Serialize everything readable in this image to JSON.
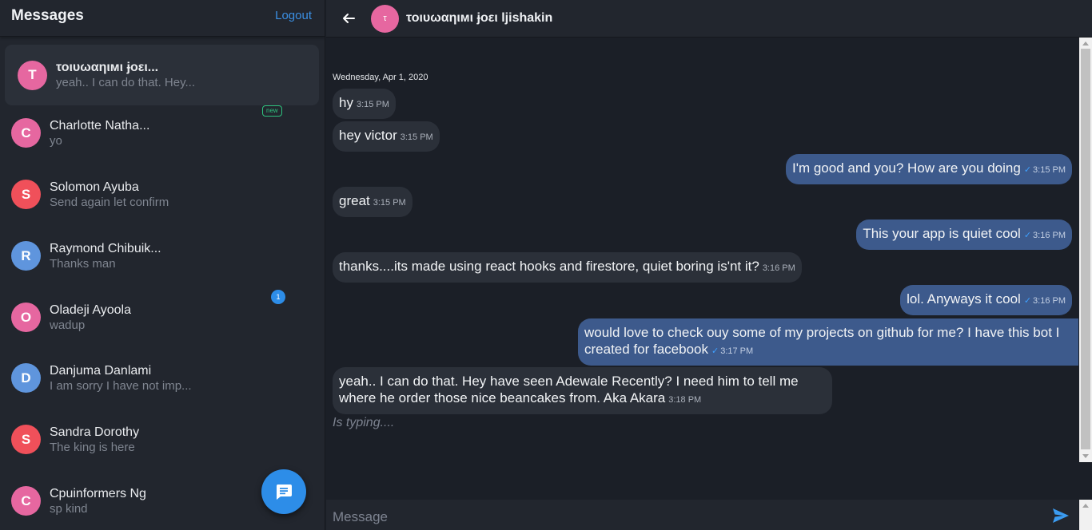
{
  "sidebar": {
    "title": "Messages",
    "logout_label": "Logout",
    "conversations": [
      {
        "initial": "T",
        "name": "τοιυωαηιмι ɉοει...",
        "preview": "yeah.. I can do that. Hey...",
        "color": "#e667a0",
        "active": true
      },
      {
        "initial": "C",
        "name": "Charlotte Natha...",
        "preview": "yo",
        "color": "#e667a0",
        "badge": "new"
      },
      {
        "initial": "S",
        "name": "Solomon Ayuba",
        "preview": "Send again let confirm",
        "color": "#f0505a"
      },
      {
        "initial": "R",
        "name": "Raymond Chibuik...",
        "preview": "Thanks man",
        "color": "#5f95dd"
      },
      {
        "initial": "O",
        "name": "Oladeji Ayoola",
        "preview": "wadup",
        "color": "#e667a0",
        "unread": "1"
      },
      {
        "initial": "D",
        "name": "Danjuma Danlami",
        "preview": "I am sorry I have not imp...",
        "color": "#5f95dd"
      },
      {
        "initial": "S",
        "name": "Sandra Dorothy",
        "preview": "The king is here",
        "color": "#f0505a"
      },
      {
        "initial": "C",
        "name": "Cpuinformers Ng",
        "preview": "sp kind",
        "color": "#e667a0"
      }
    ],
    "fab_icon": "new-message-icon"
  },
  "chat": {
    "contact_initial": "τ",
    "contact_name": "τοιυωαηιмι ɉοει ljishakin",
    "date_separator": "Wednesday, Apr 1, 2020",
    "messages": [
      {
        "dir": "in",
        "text": "hy",
        "time": "3:15 PM"
      },
      {
        "dir": "in",
        "text": "hey victor",
        "time": "3:15 PM"
      },
      {
        "dir": "out",
        "text": "I'm good and you? How are you doing",
        "time": "3:15 PM",
        "tick": "✓"
      },
      {
        "dir": "in",
        "text": "great",
        "time": "3:15 PM"
      },
      {
        "dir": "out",
        "text": "This your app is quiet cool",
        "time": "3:16 PM",
        "tick": "✓"
      },
      {
        "dir": "in",
        "text": "thanks....its made using react hooks and firestore, quiet boring is'nt it?",
        "time": "3:16 PM"
      },
      {
        "dir": "out",
        "text": "lol. Anyways it cool",
        "time": "3:16 PM",
        "tick": "✓"
      },
      {
        "dir": "out",
        "text": "would love to check ouy some of my projects on github for me? I have this bot I created for facebook",
        "time": "3:17 PM",
        "tick": "✓"
      },
      {
        "dir": "in",
        "text": "yeah.. I can do that. Hey have seen Adewale Recently? I need him to tell me where he order those nice beancakes from. Aka Akara",
        "time": "3:18 PM"
      }
    ],
    "typing_text": "Is typing....",
    "composer_placeholder": "Message",
    "icons": {
      "back": "arrow-left-icon",
      "send": "send-icon"
    }
  }
}
